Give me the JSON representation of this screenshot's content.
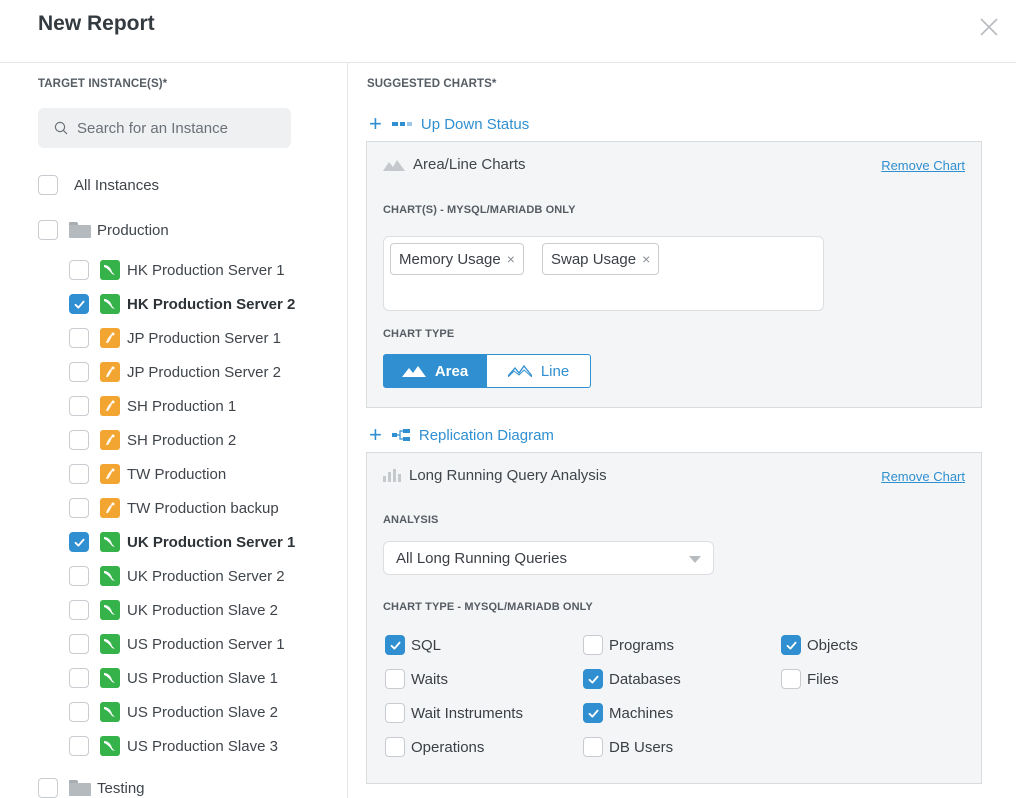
{
  "modal": {
    "title": "New Report"
  },
  "left": {
    "section_label": "TARGET INSTANCE(S)*",
    "search": {
      "placeholder": "Search for an Instance",
      "value": ""
    },
    "all_instances": {
      "label": "All Instances",
      "checked": false
    },
    "groups": [
      {
        "label": "Production",
        "checked": false,
        "items": [
          {
            "label": "HK Production Server 1",
            "type": "mysql",
            "checked": false
          },
          {
            "label": "HK Production Server 2",
            "type": "mysql",
            "checked": true
          },
          {
            "label": "JP Production Server 1",
            "type": "mariadb",
            "checked": false
          },
          {
            "label": "JP Production Server 2",
            "type": "mariadb",
            "checked": false
          },
          {
            "label": "SH Production 1",
            "type": "mariadb",
            "checked": false
          },
          {
            "label": "SH Production 2",
            "type": "mariadb",
            "checked": false
          },
          {
            "label": "TW Production",
            "type": "mariadb",
            "checked": false
          },
          {
            "label": "TW Production backup",
            "type": "mariadb",
            "checked": false
          },
          {
            "label": "UK Production Server 1",
            "type": "mysql",
            "checked": true
          },
          {
            "label": "UK Production Server 2",
            "type": "mysql",
            "checked": false
          },
          {
            "label": "UK Production Slave 2",
            "type": "mysql",
            "checked": false
          },
          {
            "label": "US Production Server 1",
            "type": "mysql",
            "checked": false
          },
          {
            "label": "US Production Slave 1",
            "type": "mysql",
            "checked": false
          },
          {
            "label": "US Production Slave 2",
            "type": "mysql",
            "checked": false
          },
          {
            "label": "US Production Slave 3",
            "type": "mysql",
            "checked": false
          }
        ]
      },
      {
        "label": "Testing",
        "checked": false,
        "items": []
      }
    ]
  },
  "right": {
    "section_label": "SUGGESTED CHARTS*",
    "add_links": [
      {
        "label": "Up Down Status"
      },
      {
        "label": "Replication Diagram"
      }
    ],
    "panels": {
      "area_line": {
        "title": "Area/Line Charts",
        "remove_label": "Remove Chart",
        "charts_label": "CHART(S) - MYSQL/MARIADB ONLY",
        "tags": [
          "Memory Usage",
          "Swap Usage"
        ],
        "tag_remove_glyph": "×",
        "chart_type_label": "CHART TYPE",
        "chart_types": [
          {
            "label": "Area",
            "selected": true
          },
          {
            "label": "Line",
            "selected": false
          }
        ]
      },
      "long_running": {
        "title": "Long Running Query Analysis",
        "remove_label": "Remove Chart",
        "analysis_label": "ANALYSIS",
        "analysis_value": "All Long Running Queries",
        "chart_type_label": "CHART TYPE - MYSQL/MARIADB ONLY",
        "options": [
          {
            "label": "SQL",
            "checked": true
          },
          {
            "label": "Waits",
            "checked": false
          },
          {
            "label": "Wait Instruments",
            "checked": false
          },
          {
            "label": "Operations",
            "checked": false
          },
          {
            "label": "Programs",
            "checked": false
          },
          {
            "label": "Databases",
            "checked": true
          },
          {
            "label": "Machines",
            "checked": true
          },
          {
            "label": "DB Users",
            "checked": false
          },
          {
            "label": "Objects",
            "checked": true
          },
          {
            "label": "Files",
            "checked": false
          }
        ]
      }
    }
  },
  "colors": {
    "accent": "#2f8fd0",
    "mysql_icon": "#35b34a",
    "mariadb_icon": "#f2a531",
    "panel_bg": "#f4f5f6"
  },
  "icons": {
    "close": "close-icon",
    "search": "search-icon",
    "folder": "folder-icon",
    "mysql": "mysql-dolphin-icon",
    "mariadb": "mariadb-seal-icon",
    "up_down": "up-down-status-icon",
    "replication": "replication-diagram-icon",
    "area": "area-chart-icon",
    "line": "line-chart-icon",
    "bar": "bar-chart-icon"
  }
}
